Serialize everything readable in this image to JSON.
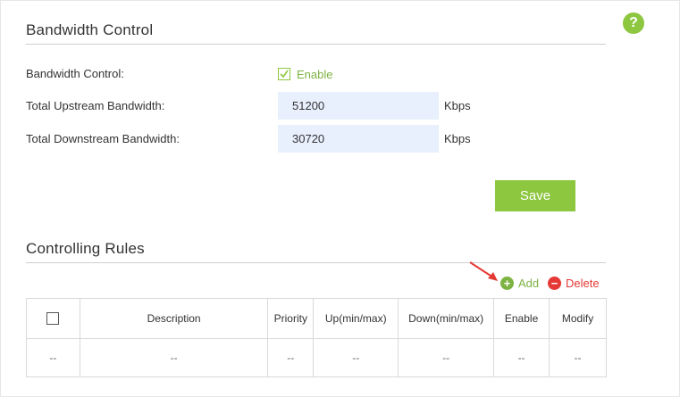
{
  "bandwidth": {
    "title": "Bandwidth Control",
    "control_label": "Bandwidth Control:",
    "enable_label": "Enable",
    "enabled": true,
    "upstream_label": "Total Upstream Bandwidth:",
    "upstream_value": "51200",
    "downstream_label": "Total Downstream Bandwidth:",
    "downstream_value": "30720",
    "unit": "Kbps",
    "save_label": "Save"
  },
  "rules": {
    "title": "Controlling Rules",
    "add_label": "Add",
    "delete_label": "Delete",
    "columns": [
      "Description",
      "Priority",
      "Up(min/max)",
      "Down(min/max)",
      "Enable",
      "Modify"
    ],
    "row": [
      "--",
      "--",
      "--",
      "--",
      "--",
      "--",
      "--"
    ]
  },
  "help": {
    "icon_text": "?"
  },
  "colors": {
    "accent": "#8dc63f",
    "delete": "#e53935",
    "input_bg": "#e8f0fe",
    "arrow": "#e53935"
  }
}
